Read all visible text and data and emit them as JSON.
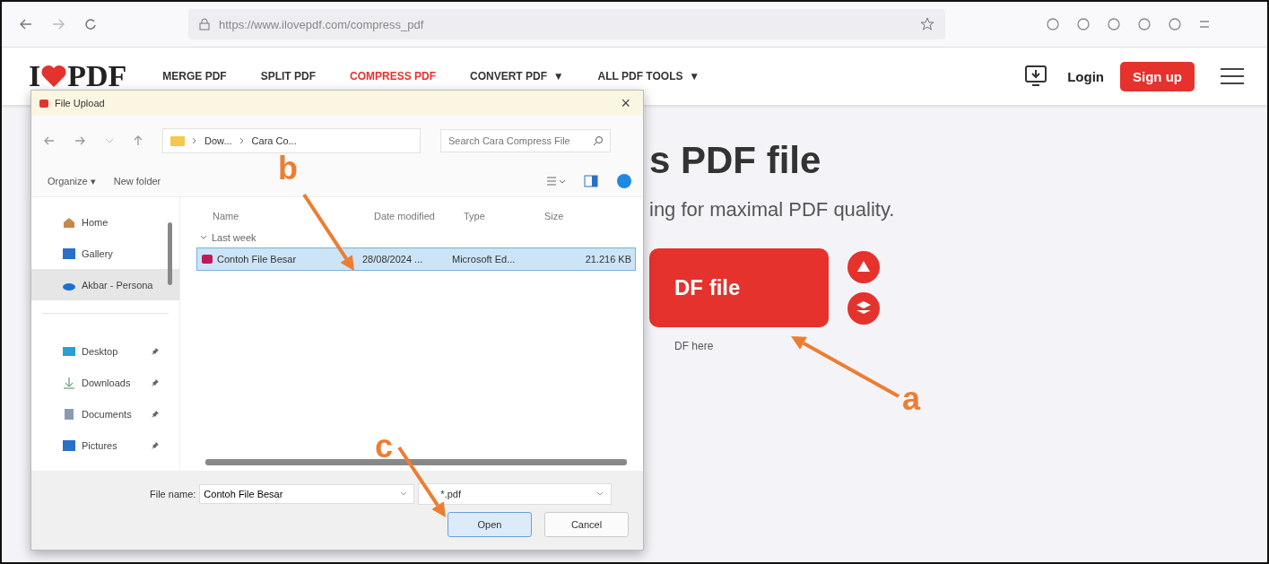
{
  "browser": {
    "address": "https://www.ilovepdf.com/compress_pdf"
  },
  "site": {
    "logo_left": "I",
    "logo_right": "PDF",
    "nav": [
      {
        "label": "MERGE PDF",
        "selected": false,
        "dropdown": false
      },
      {
        "label": "SPLIT PDF",
        "selected": false,
        "dropdown": false
      },
      {
        "label": "COMPRESS PDF",
        "selected": true,
        "dropdown": false
      },
      {
        "label": "CONVERT PDF",
        "selected": false,
        "dropdown": true
      },
      {
        "label": "ALL PDF TOOLS",
        "selected": false,
        "dropdown": true
      }
    ],
    "caret": "▼",
    "login": "Login",
    "signup": "Sign up"
  },
  "page": {
    "heading": "s PDF file",
    "subtitle": "ing for maximal PDF quality.",
    "upload_button": "DF file",
    "drop_hint": "DF here"
  },
  "dialog": {
    "title": "File Upload",
    "close": "×",
    "path": [
      "Dow...",
      "Cara Co..."
    ],
    "search": {
      "placeholder": "Search Cara Compress File"
    },
    "toolbar": [
      "Organize ▾",
      "New folder"
    ],
    "sidebar": [
      {
        "label": "Home",
        "kind": "home",
        "selected": false,
        "pinned": false
      },
      {
        "label": "Gallery",
        "kind": "gallery",
        "selected": false,
        "pinned": false
      },
      {
        "label": "Akbar - Persona",
        "kind": "cloud",
        "selected": true,
        "pinned": false
      },
      {
        "label": "Desktop",
        "kind": "desktop",
        "selected": false,
        "pinned": true
      },
      {
        "label": "Downloads",
        "kind": "downloads",
        "selected": false,
        "pinned": true
      },
      {
        "label": "Documents",
        "kind": "documents",
        "selected": false,
        "pinned": true
      },
      {
        "label": "Pictures",
        "kind": "pictures",
        "selected": false,
        "pinned": true
      }
    ],
    "columns": [
      "Name",
      "Date modified",
      "Type",
      "Size"
    ],
    "group": "Last week",
    "files": [
      {
        "name": "Contoh File Besar",
        "date": "28/08/2024 ...",
        "type": "Microsoft Ed...",
        "size": "21.216 KB",
        "selected": true
      }
    ],
    "file_name_label": "File name:",
    "file_name": "Contoh File Besar",
    "file_type": "*.pdf",
    "open": "Open",
    "cancel": "Cancel"
  },
  "annotations": [
    {
      "label": "a"
    },
    {
      "label": "b"
    },
    {
      "label": "c"
    }
  ]
}
